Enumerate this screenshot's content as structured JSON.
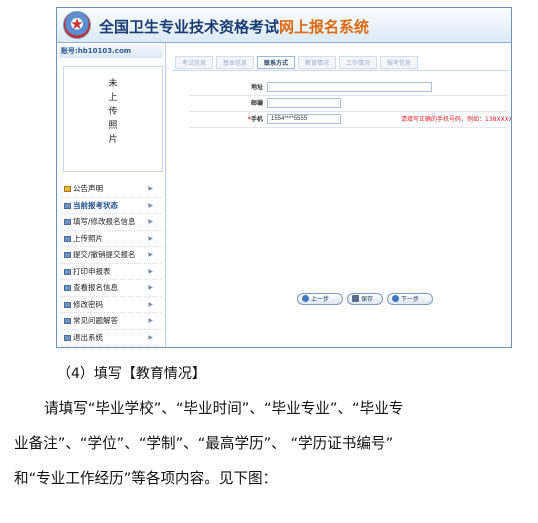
{
  "banner": {
    "title": "全国卫生专业技术资格考试",
    "subtitle": "网上报名系统"
  },
  "sidebar": {
    "account": "账号:hb10103.com",
    "photo_text": [
      "未",
      "上",
      "传",
      "照",
      "片"
    ],
    "menu": [
      {
        "label": "公告声明",
        "icon": "home-icon"
      },
      {
        "label": "当前报考状态",
        "icon": "list-icon"
      },
      {
        "label": "填写/修改报名信息",
        "icon": "edit-icon"
      },
      {
        "label": "上传照片",
        "icon": "photo-icon"
      },
      {
        "label": "提交/撤销提交报名",
        "icon": "submit-icon"
      },
      {
        "label": "打印申报表",
        "icon": "print-icon"
      },
      {
        "label": "查看报名信息",
        "icon": "view-icon"
      },
      {
        "label": "修改密码",
        "icon": "key-icon"
      },
      {
        "label": "常见问题解答",
        "icon": "help-icon"
      },
      {
        "label": "退出系统",
        "icon": "exit-icon"
      }
    ]
  },
  "tabs": [
    "考试信息",
    "基本信息",
    "联系方式",
    "教育情况",
    "工作情况",
    "报考信息"
  ],
  "active_tab": "联系方式",
  "form": {
    "address_label": "地址",
    "address_value": "",
    "postcode_label": "邮编",
    "postcode_value": "",
    "phone_required": "*",
    "phone_label": "手机",
    "phone_value": "1554****5555",
    "phone_hint": "请填写正确的手机号码，例如：138XXXXXXXX"
  },
  "buttons": {
    "prev": "上一步",
    "save": "保存",
    "next": "下一步"
  },
  "caption": "（4）填写【教育情况】",
  "paragraph": [
    "请填写“毕业学校”、“毕业时间”、“毕业专业”、“毕业专",
    "业备注”、“学位”、“学制”、“最高学历”、 “学历证书编号”",
    "和“专业工作经历”等各项内容。见下图："
  ]
}
